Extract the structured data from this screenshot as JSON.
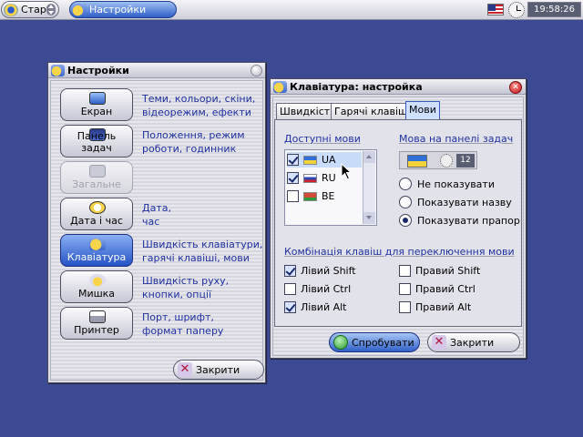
{
  "taskbar": {
    "start_label": "Старт",
    "task_label": "Настройки",
    "clock": "19:58:26"
  },
  "settings_window": {
    "title": "Настройки",
    "categories": [
      {
        "label": "Екран",
        "desc1": "Теми, кольори, скіни,",
        "desc2": "відеорежим, ефекти",
        "state": "normal"
      },
      {
        "label": "Панель задач",
        "desc1": "Положення, режим",
        "desc2": "роботи, годинник",
        "state": "normal"
      },
      {
        "label": "Загальне",
        "desc1": "",
        "desc2": "",
        "state": "disabled"
      },
      {
        "label": "Дата і час",
        "desc1": "Дата,",
        "desc2": "час",
        "state": "normal"
      },
      {
        "label": "Клавіатура",
        "desc1": "Швидкість клавіатури,",
        "desc2": "гарячі клавіші, мови",
        "state": "active"
      },
      {
        "label": "Мишка",
        "desc1": "Швидкість руху,",
        "desc2": "кнопки, опції",
        "state": "normal"
      },
      {
        "label": "Принтер",
        "desc1": "Порт, шрифт,",
        "desc2": "формат паперу",
        "state": "normal"
      }
    ],
    "close_label": "Закрити"
  },
  "keyboard_window": {
    "title": "Клавіатура: настройка",
    "tabs": [
      "Швидкість",
      "Гарячі клавіші",
      "Мови"
    ],
    "active_tab": "Мови",
    "available_title": "Доступні мови",
    "languages": [
      {
        "code": "UA",
        "checked": true,
        "selected": true
      },
      {
        "code": "RU",
        "checked": true,
        "selected": false
      },
      {
        "code": "BE",
        "checked": false,
        "selected": false
      }
    ],
    "panel_title": "Мова на панелі задач",
    "indicator_time": "12",
    "radio_options": [
      {
        "label": "Не показувати",
        "checked": false
      },
      {
        "label": "Показувати назву",
        "checked": false
      },
      {
        "label": "Показувати прапор",
        "checked": true
      }
    ],
    "combo_title": "Комбінація клавіш для переключення мови",
    "keys": [
      {
        "label": "Лівий Shift",
        "checked": true
      },
      {
        "label": "Правий Shift",
        "checked": false
      },
      {
        "label": "Лівий Ctrl",
        "checked": false
      },
      {
        "label": "Правий Ctrl",
        "checked": false
      },
      {
        "label": "Лівий Alt",
        "checked": true
      },
      {
        "label": "Правий Alt",
        "checked": false
      }
    ],
    "try_label": "Спробувати",
    "close_label": "Закрити"
  }
}
